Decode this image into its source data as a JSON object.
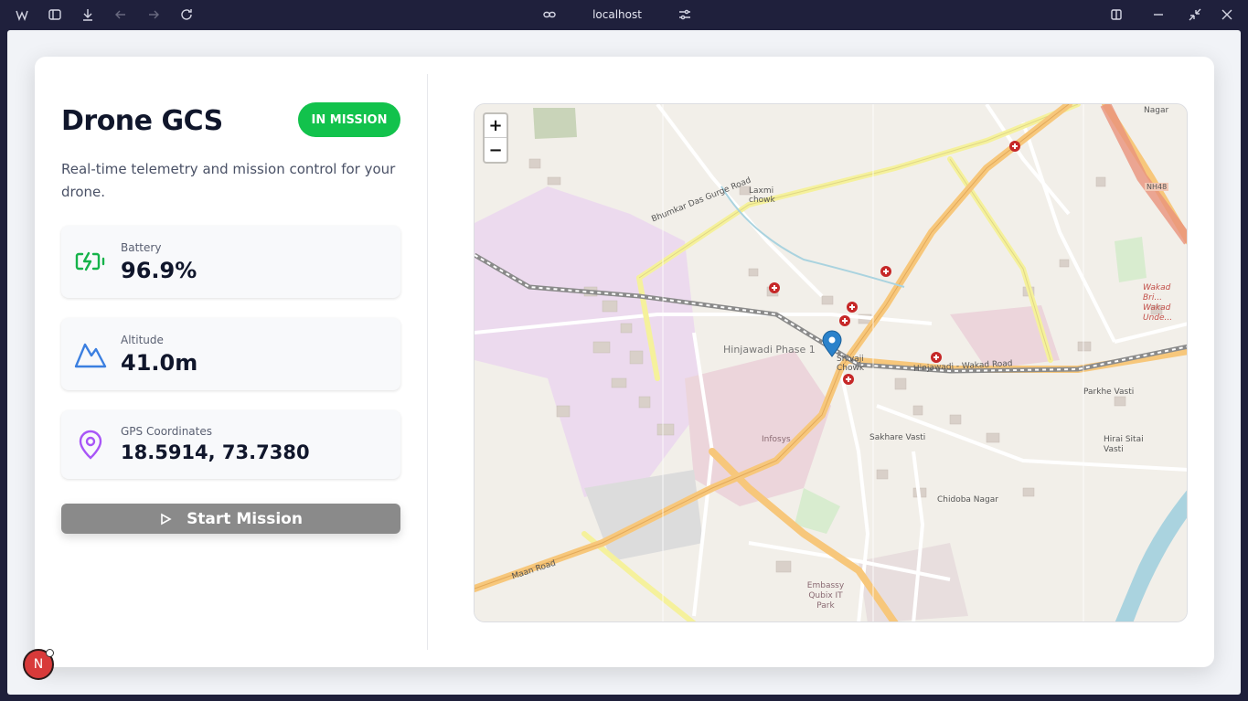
{
  "browser": {
    "address": "localhost"
  },
  "app": {
    "title": "Drone GCS",
    "status_badge": "IN MISSION",
    "subtitle": "Real-time telemetry and mission control for your drone.",
    "stats": [
      {
        "label": "Battery",
        "value": "96.9%",
        "icon": "battery-charging-icon",
        "color": "#16b34a"
      },
      {
        "label": "Altitude",
        "value": "41.0m",
        "icon": "mountain-icon",
        "color": "#3b7fe0"
      },
      {
        "label": "GPS Coordinates",
        "value": "18.5914, 73.7380",
        "icon": "map-pin-icon",
        "color": "#a855f7"
      }
    ],
    "start_button": "Start Mission"
  },
  "map": {
    "zoom_in": "+",
    "zoom_out": "−",
    "labels": {
      "hinjawadi_phase": "Hinjawadi Phase 1",
      "shivaji_chowk": "Shivaji Chowk",
      "hinjawadi_wakad_road": "Hinjawadi - Wakad Road",
      "sakhare_vasti": "Sakhare Vasti",
      "chidoba_nagar": "Chidoba Nagar",
      "parkhe_vasti": "Parkhe Vasti",
      "hirai_sitai_vasti": "Hirai Sitai Vasti",
      "laxmi_chowk": "Laxmi chowk",
      "bhumkar_road": "Bhumkar Das Gurge Road",
      "maan_road": "Maan Road",
      "infosys": "Infosys",
      "embassy": "Embassy Qubix IT Park",
      "nagar": "Nagar",
      "nh48": "NH48",
      "wakad": "Wakad Bri... Wakad Unde..."
    }
  },
  "avatar": {
    "initial": "N"
  }
}
